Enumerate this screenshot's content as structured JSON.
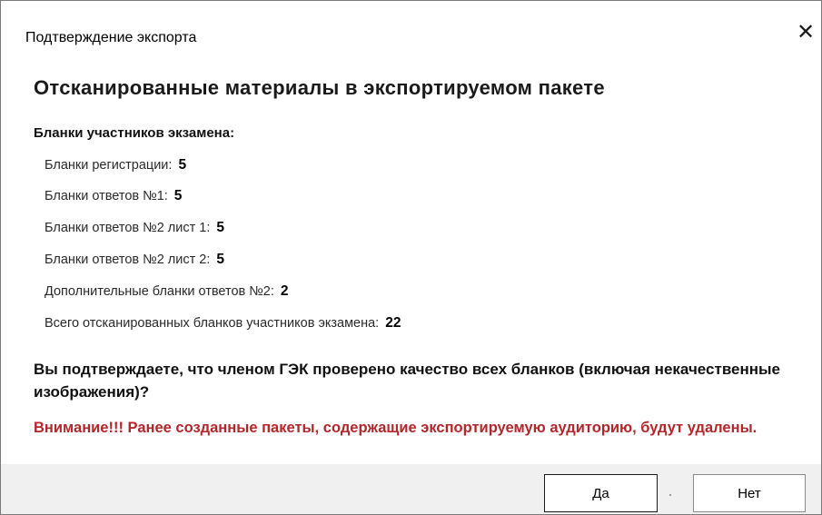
{
  "window": {
    "title": "Подтверждение экспорта",
    "close_glyph": "✕"
  },
  "heading": "Отсканированные материалы в экспортируемом пакете",
  "section_label": "Бланки участников экзамена:",
  "items": [
    {
      "label": "Бланки регистрации:",
      "value": "5"
    },
    {
      "label": "Бланки ответов №1:",
      "value": "5"
    },
    {
      "label": "Бланки ответов №2 лист 1:",
      "value": "5"
    },
    {
      "label": "Бланки ответов №2 лист 2:",
      "value": "5"
    },
    {
      "label": "Дополнительные бланки ответов №2:",
      "value": "2"
    },
    {
      "label": "Всего отсканированных бланков участников экзамена:",
      "value": "22"
    }
  ],
  "question": "Вы подтверждаете, что членом ГЭК проверено качество всех бланков (включая некачественные изображения)?",
  "warning": "Внимание!!! Ранее созданные пакеты, содержащие экспортируемую аудиторию, будут удалены.",
  "buttons": {
    "yes": "Да",
    "no": "Нет"
  },
  "colors": {
    "warning": "#b3262a",
    "footer": "#f0f0f0"
  }
}
